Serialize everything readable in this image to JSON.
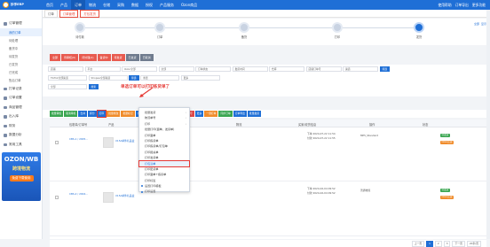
{
  "app": {
    "logo_text": "妙手ERP"
  },
  "nav": {
    "items": [
      "首页",
      "产品",
      "订单",
      "物流",
      "仓储",
      "采购",
      "数据",
      "授权",
      "产品服务",
      "Ozon商品"
    ],
    "active": 2,
    "right": [
      "使用帮助",
      "订单导出",
      "更多功能"
    ]
  },
  "sidebar": {
    "groups": [
      {
        "label": "订单管理",
        "subs": [
          "我的订单",
          "待处理",
          "备货中",
          "待发货",
          "已发货",
          "已完成",
          "售后订单"
        ]
      },
      {
        "label": "打单记录"
      },
      {
        "label": "订单设置"
      },
      {
        "label": "商品管理"
      },
      {
        "label": "出入库"
      },
      {
        "label": "财务"
      },
      {
        "label": "数据分析"
      },
      {
        "label": "常用工具"
      }
    ],
    "active_sub": 0
  },
  "ad": {
    "line1": "OZON/WB",
    "line2": "跨境物流",
    "cta": "免费下载使用"
  },
  "tabs": [
    "订单",
    "订单管理",
    "打包发货"
  ],
  "steps": [
    "待付款",
    "订单",
    "备货",
    "打印",
    "发货"
  ],
  "step_actions": [
    "全部",
    "显示"
  ],
  "status_row": [
    "全部",
    "待审核(0)",
    "待处理(4)",
    "备货中",
    "待发货",
    "已发货",
    "已取消"
  ],
  "filters": {
    "row1": [
      "店铺",
      "平台",
      "Ozon全部",
      "全部",
      "订单状态",
      "发货时间",
      "仓库",
      "店铺订单号",
      "渠道",
      "筛选"
    ],
    "row2": [
      "TikTok全部渠道",
      "Shopee全部渠道",
      "筛选",
      "重置",
      "更多"
    ],
    "row3": [
      "全部",
      "搜索"
    ]
  },
  "annotation": "单选订单可以打印拣货单了",
  "toolbar": [
    "批量审核",
    "取消审核",
    "合并",
    "拆分",
    "打印",
    "批量修改",
    "批量标记",
    "打单",
    "导出",
    "标记发货",
    "发货",
    "申请运单号",
    "更多",
    "一键打单",
    "同步订单",
    "订单导出",
    "批量发货"
  ],
  "dropdown": {
    "items": [
      "批量发货",
      "物流单号",
      "打印",
      "批量打印(面单、发货单)",
      "打印面单",
      "打印拣货单",
      "打印拣货单/打包单",
      "打印报关单",
      "打印发货单",
      "打包清单",
      "打印配货单",
      "打印面单+拣货单",
      "打印标签",
      "设置打印模板",
      "打印设置"
    ],
    "highlighted": 9
  },
  "table": {
    "headers": [
      "包裹单/订单号",
      "产品",
      "下单时间",
      "商品",
      "物流",
      "买家/收货信息",
      "操作",
      "状态"
    ],
    "rows": [
      {
        "order": "CBS-1 / 2005...",
        "product": "X15A单件礼品盒",
        "time1": "下单 2024-07-22 11:54",
        "time2": "付款 2024-07-22 11:55",
        "buyer": "MP5_Standard",
        "status": "待发货",
        "shop": "Ozon店铺"
      },
      {
        "order": "CBS-2 / 2004...",
        "product": "X15A单件礼品盒",
        "time1": "下单 2024-02-04 09:52",
        "time2": "付款 2024-02-04 09:52",
        "buyer": "普通物流",
        "status": "待发货",
        "shop": "Ozon店铺"
      }
    ]
  },
  "pager": [
    "上一页",
    "1",
    "2",
    "3",
    "下一页",
    "20条/页"
  ]
}
